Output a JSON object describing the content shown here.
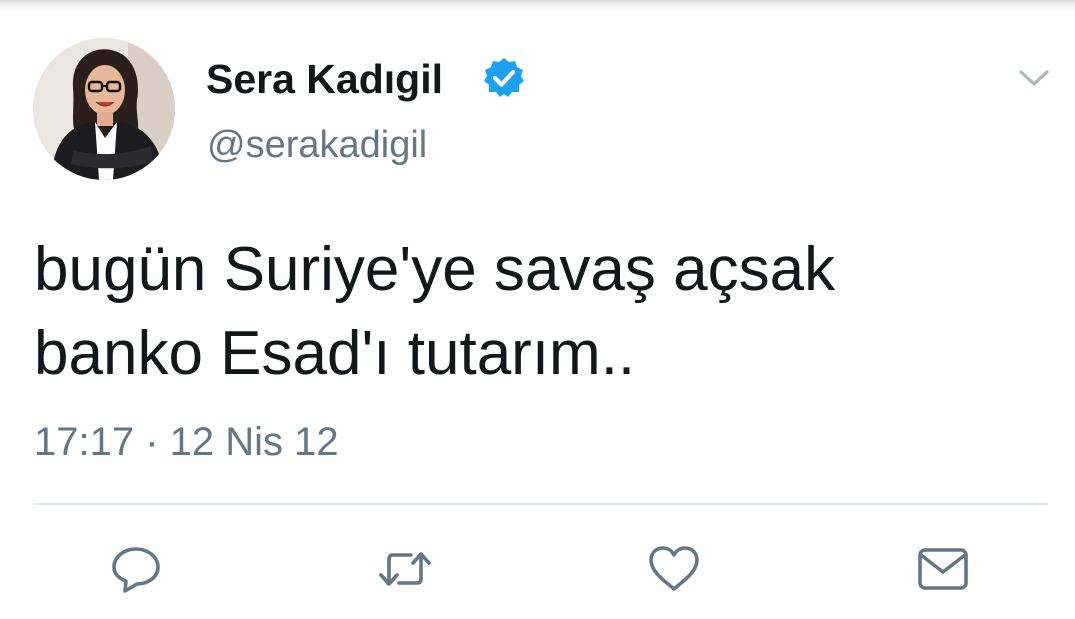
{
  "tweet": {
    "author": {
      "display_name": "Sera Kadıgil",
      "handle": "@serakadigil",
      "verified": true
    },
    "text": "bugün Suriye'ye savaş açsak\nbanko Esad'ı tutarım..",
    "timestamp": "17:17 · 12 Nis 12"
  },
  "icons": {
    "menu": "chevron-down-icon",
    "verified": "verified-badge-icon",
    "actions": [
      "reply-icon",
      "retweet-icon",
      "like-icon",
      "direct-message-icon"
    ]
  },
  "colors": {
    "text_primary": "#14171a",
    "text_secondary": "#657786",
    "verified_blue": "#1da1f2",
    "divider": "#e1e8ed"
  }
}
